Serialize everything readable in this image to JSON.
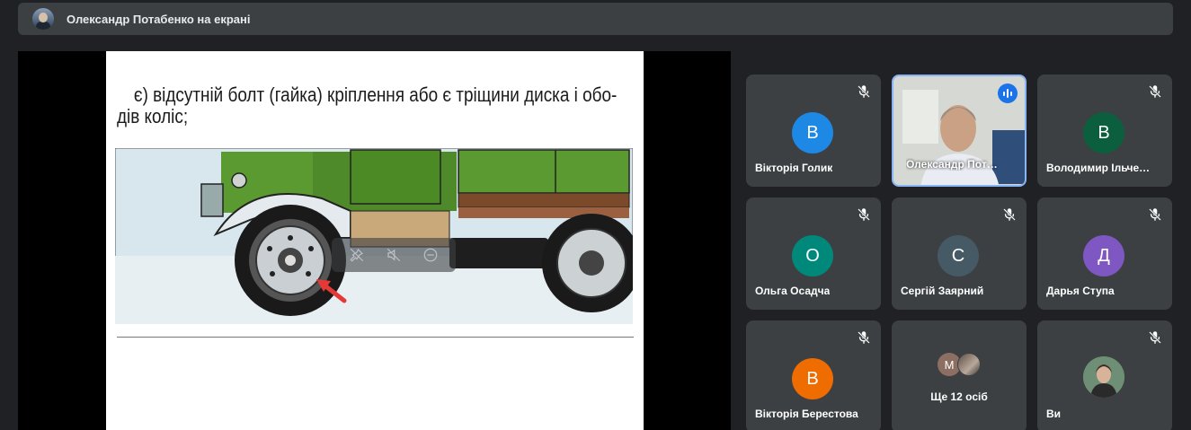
{
  "top_bar": {
    "presenting_text": "Олександр Потабенко на екрані"
  },
  "presentation": {
    "slide_line1": "є) відсутній болт (гайка) кріплення або є тріщини диска і обо-",
    "slide_line2": "дів коліс;",
    "image_description_icon": "truck-wheel-illustration"
  },
  "participants": [
    {
      "name": "Вікторія Голик",
      "initial": "В",
      "color": "#1e88e5",
      "muted": true
    },
    {
      "name": "Олександр Пот…",
      "video": true,
      "speaking": true
    },
    {
      "name": "Володимир Ільче…",
      "initial": "В",
      "color": "#0b5f3e",
      "muted": true
    },
    {
      "name": "Ольга Осадча",
      "initial": "О",
      "color": "#00897b",
      "muted": true
    },
    {
      "name": "Сергій Заярний",
      "initial": "С",
      "color": "#455a64",
      "muted": true
    },
    {
      "name": "Дарья Ступа",
      "initial": "Д",
      "color": "#7e57c2",
      "muted": true
    },
    {
      "name": "Вікторія Берестова",
      "initial": "В",
      "color": "#ef6c00",
      "muted": true
    },
    {
      "others_label": "Ще 12 осіб",
      "mini_initial": "М"
    },
    {
      "name": "Ви",
      "muted": true,
      "self_photo": true
    }
  ]
}
